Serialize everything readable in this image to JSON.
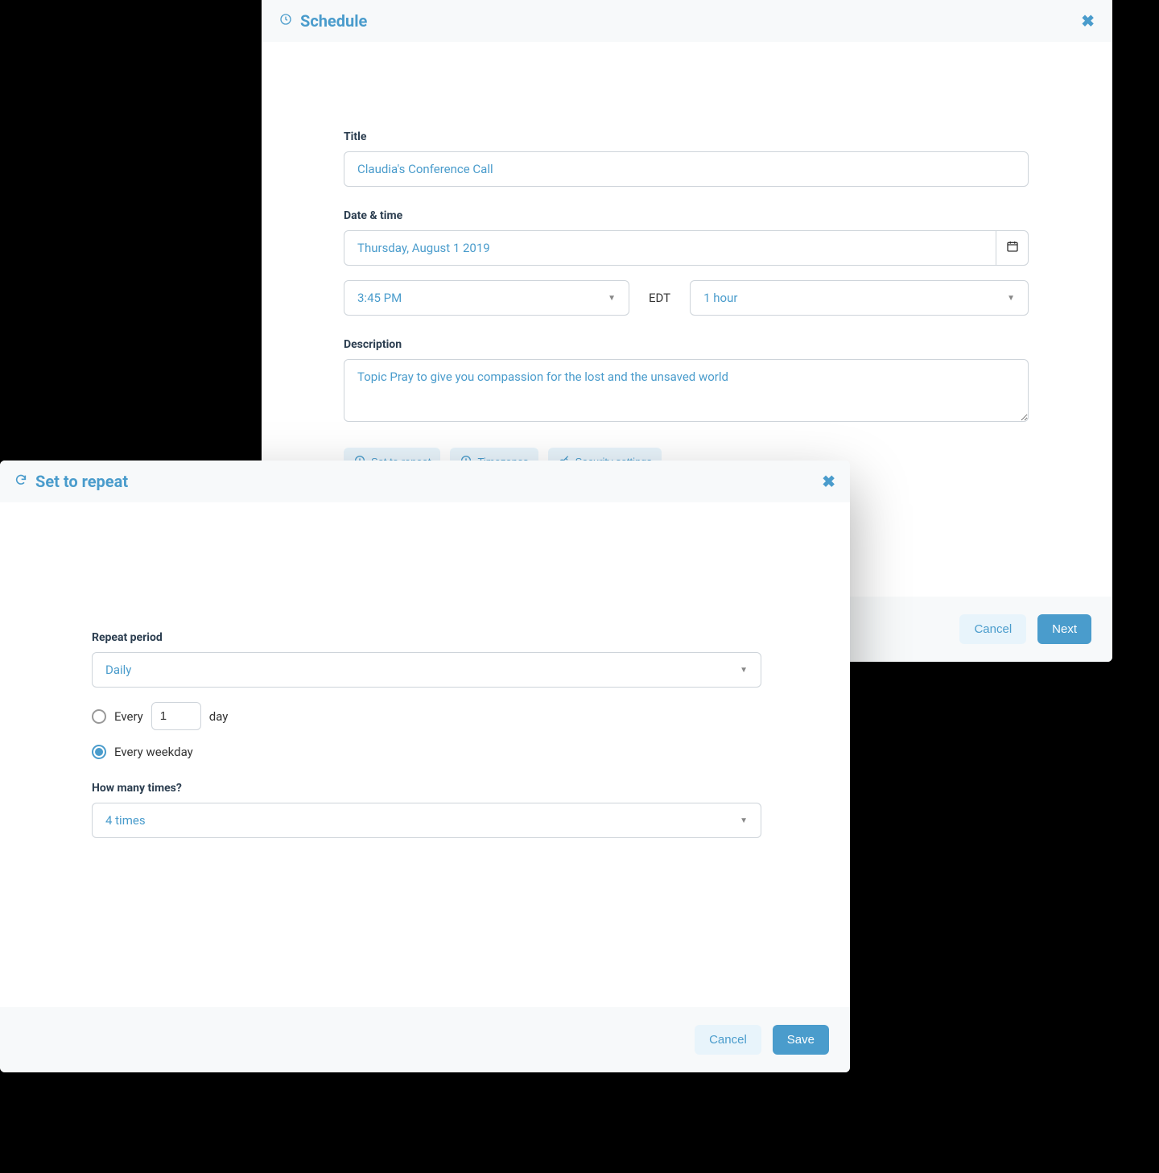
{
  "schedule": {
    "header_title": "Schedule",
    "title_label": "Title",
    "title_value": "Claudia's Conference Call",
    "datetime_label": "Date & time",
    "date_value": "Thursday, August 1 2019",
    "time_value": "3:45 PM",
    "timezone": "EDT",
    "duration_value": "1 hour",
    "description_label": "Description",
    "description_value": "Topic Pray to give you compassion for the lost and the unsaved world",
    "pills": {
      "repeat": "Set to repeat",
      "timezones": "Timezones",
      "security": "Security settings"
    },
    "footer": {
      "cancel": "Cancel",
      "next": "Next"
    }
  },
  "repeat": {
    "header_title": "Set to repeat",
    "period_label": "Repeat period",
    "period_value": "Daily",
    "every_label": "Every",
    "every_input": "1",
    "every_unit": "day",
    "weekday_label": "Every weekday",
    "times_label": "How many times?",
    "times_value": "4 times",
    "footer": {
      "cancel": "Cancel",
      "save": "Save"
    }
  }
}
